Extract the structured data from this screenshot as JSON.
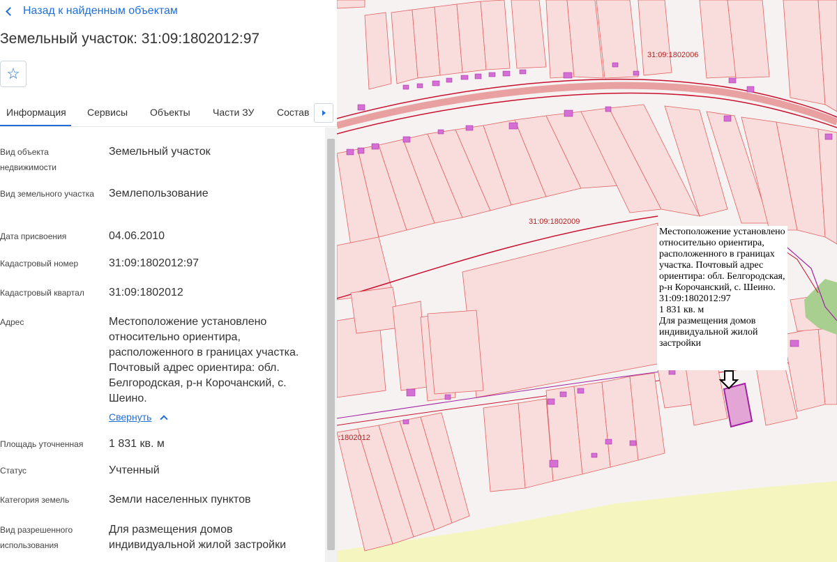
{
  "panel": {
    "back_label": "Назад к найденным объектам",
    "title": "Земельный участок: 31:09:1802012:97",
    "favorite_icon": "star-icon",
    "tabs": [
      {
        "label": "Информация"
      },
      {
        "label": "Сервисы"
      },
      {
        "label": "Объекты"
      },
      {
        "label": "Части ЗУ"
      },
      {
        "label": "Состав"
      }
    ],
    "tab_next_icon": "caret-right-icon",
    "fields": [
      {
        "label": "Вид объекта недвижимости",
        "value": "Земельный участок"
      },
      {
        "label": "Вид земельного участка",
        "value": "Землепользование"
      },
      {
        "label": "Дата присвоения",
        "value": "04.06.2010"
      },
      {
        "label": "Кадастровый номер",
        "value": "31:09:1802012:97"
      },
      {
        "label": "Кадастровый квартал",
        "value": "31:09:1802012"
      },
      {
        "label": "Адрес",
        "value": "Местоположение установлено относительно ориентира, расположенного в границах участка. Почтовый адрес ориентира: обл. Белгородская, р-н Корочанский, с. Шеино."
      },
      {
        "label": "Площадь уточненная",
        "value": "1 831 кв. м"
      },
      {
        "label": "Статус",
        "value": "Учтенный"
      },
      {
        "label": "Категория земель",
        "value": "Земли населенных пунктов"
      },
      {
        "label": "Вид разрешенного использования",
        "value": "Для размещения домов индивидуальной жилой застройки"
      }
    ],
    "collapse_label": "Свернуть"
  },
  "map": {
    "labels": [
      "31:09:1802006",
      "31:09:1802009",
      ":1802012"
    ],
    "tooltip": {
      "address": "Местоположение установлено относительно ориентира, расположенного в границах участка. Почтовый адрес ориентира: обл. Белгородская, р-н Корочанский, с. Шеино.",
      "cadastral_number": "31:09:1802012:97",
      "area": "1 831 кв. м",
      "usage": "Для размещения домов индивидуальной жилой застройки"
    },
    "colors": {
      "parcel_fill": "#f9dcdc",
      "parcel_border": "#e06060",
      "block_border": "#c8102e",
      "building": "#d46fd4",
      "selected": "#a020a0",
      "field": "#f5f5c0",
      "trees": "#a8cf8f"
    }
  }
}
